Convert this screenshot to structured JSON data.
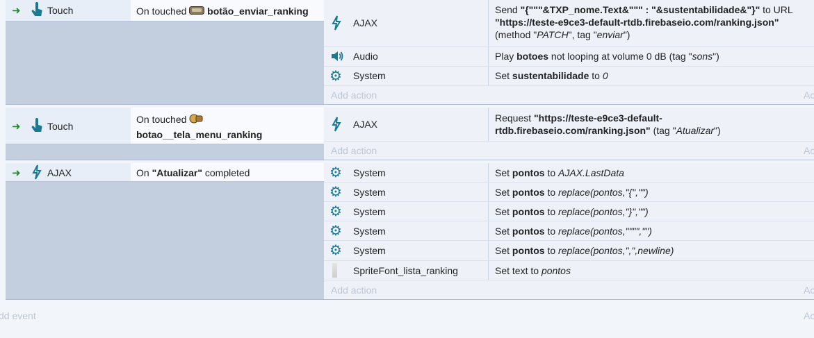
{
  "colors": {
    "accent_icon": "#1a7a93",
    "arrow": "#1e8a2c",
    "block_bg": "#c3cfdf"
  },
  "events": [
    {
      "condition": {
        "object": "Touch",
        "icon": "touch-icon",
        "prefix": "On touched",
        "target": "botão_enviar_ranking"
      },
      "actions": [
        {
          "object": "AJAX",
          "icon": "ajax-icon",
          "lines": [
            "Send \"{\"\"\"&TXP_nome.Text&\"\"\" : \"&sustentabilidade&\"}\" to URL",
            "\"https://teste-e9ce3-default-rtdb.firebaseio.com/ranking.json\"",
            "(method \"PATCH\", tag \"enviar\")"
          ],
          "parts": {
            "send": "Send ",
            "data": "\"{\"\"\"&TXP_nome.Text&\"\"\" : \"&sustentabilidade&\"}\"",
            "to_url": " to URL",
            "url": "\"https://teste-e9ce3-default-rtdb.firebaseio.com/ranking.json\"",
            "method_pre": "(method \"",
            "method": "PATCH",
            "tag_pre": "\", tag \"",
            "tag": "enviar",
            "close": "\")"
          }
        },
        {
          "object": "Audio",
          "icon": "speaker-icon",
          "parts": {
            "pre": "Play ",
            "name": "botoes",
            "post": " not looping at volume 0 dB (tag \"",
            "tag": "sons",
            "close": "\")"
          }
        },
        {
          "object": "System",
          "icon": "gear-icon",
          "parts": {
            "pre": "Set ",
            "var": "sustentabilidade",
            "mid": " to ",
            "val": "0"
          }
        }
      ]
    },
    {
      "condition": {
        "object": "Touch",
        "icon": "touch-icon",
        "prefix": "On touched",
        "target": "botao__tela_menu_ranking"
      },
      "actions": [
        {
          "object": "AJAX",
          "icon": "ajax-icon",
          "parts": {
            "pre": "Request ",
            "url1": "\"https://teste-e9ce3-default-",
            "url2": "rtdb.firebaseio.com/ranking.json\"",
            "tag_pre": " (tag \"",
            "tag": "Atualizar",
            "close": "\")"
          }
        }
      ]
    },
    {
      "condition": {
        "object": "AJAX",
        "icon": "ajax-icon",
        "prefix": "On ",
        "target": "\"Atualizar\"",
        "suffix": " completed"
      },
      "actions": [
        {
          "object": "System",
          "icon": "gear-icon",
          "parts": {
            "pre": "Set ",
            "var": "pontos",
            "mid": " to ",
            "val": "AJAX.LastData"
          }
        },
        {
          "object": "System",
          "icon": "gear-icon",
          "parts": {
            "pre": "Set ",
            "var": "pontos",
            "mid": " to ",
            "val": "replace(pontos,\"{\",\"\")"
          }
        },
        {
          "object": "System",
          "icon": "gear-icon",
          "parts": {
            "pre": "Set ",
            "var": "pontos",
            "mid": " to ",
            "val": "replace(pontos,\"}\",\"\")"
          }
        },
        {
          "object": "System",
          "icon": "gear-icon",
          "parts": {
            "pre": "Set ",
            "var": "pontos",
            "mid": " to ",
            "val": "replace(pontos,\"\"\"\",\"\")"
          }
        },
        {
          "object": "System",
          "icon": "gear-icon",
          "parts": {
            "pre": "Set ",
            "var": "pontos",
            "mid": " to ",
            "val": "replace(pontos,\",\",newline)"
          }
        },
        {
          "object": "SpriteFont_lista_ranking",
          "icon": "spritefont-icon",
          "parts": {
            "pre": "Set text to ",
            "val": "pontos"
          }
        }
      ]
    }
  ],
  "add_action": "Add action",
  "add_action_right": "Ac",
  "add_event": "dd event",
  "add_event_right": "Ac"
}
